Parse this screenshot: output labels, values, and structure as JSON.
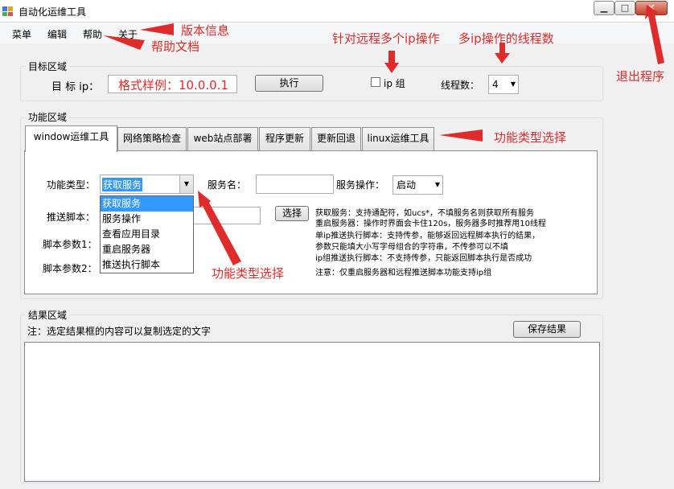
{
  "window": {
    "title": "自动化运维工具"
  },
  "menu": [
    "菜单",
    "编辑",
    "帮助",
    "关于"
  ],
  "target": {
    "group_title": "目标区域",
    "ip_label": "目 标 ip：",
    "ip_placeholder": "格式样例：10.0.0.1",
    "run_button": "执行",
    "ip_group_label": "ip 组",
    "threads_label": "线程数：",
    "threads_value": "4"
  },
  "function_area": {
    "group_title": "功能区域",
    "tabs": [
      "window运维工具",
      "网络策略检查",
      "web站点部署",
      "程序更新",
      "更新回退",
      "linux运维工具"
    ],
    "type_label": "功能类型：",
    "type_value": "获取服务",
    "type_options": [
      "获取服务",
      "服务操作",
      "查看应用目录",
      "重启服务器",
      "推送执行脚本"
    ],
    "service_name_label": "服务名：",
    "service_op_label": "服务操作：",
    "service_op_value": "启动",
    "push_script_label": "推送脚本：",
    "select_button": "选择",
    "param1_label": "脚本参数1：",
    "param2_label": "脚本参数2：",
    "help": [
      "获取服务：支持通配符，如ucs*，不填服务名则获取所有服务",
      "重启服务器：操作时界面会卡住120s，服务器多时推荐用10线程",
      "单ip推送执行脚本：支持传参，能够返回远程脚本执行的结果，",
      "参数只能填大小写字母组合的字符串，不传参可以不填",
      "ip组推送执行脚本：不支持传参，只能返回脚本执行是否成功",
      "注意：仅重启服务器和远程推送脚本功能支持ip组"
    ]
  },
  "result": {
    "group_title": "结果区域",
    "note": "注：选定结果框的内容可以复制选定的文字",
    "save_button": "保存结果"
  },
  "annotations": {
    "version_info": "版本信息",
    "help_doc": "帮助文档",
    "remote_multi_ip": "针对远程多个ip操作",
    "multi_ip_threads": "多ip操作的线程数",
    "exit_program": "退出程序",
    "function_type_select_tabs": "功能类型选择",
    "function_type_select_combo": "功能类型选择"
  },
  "colors": {
    "annotation": "#e02b2b",
    "selection": "#3399ff"
  }
}
